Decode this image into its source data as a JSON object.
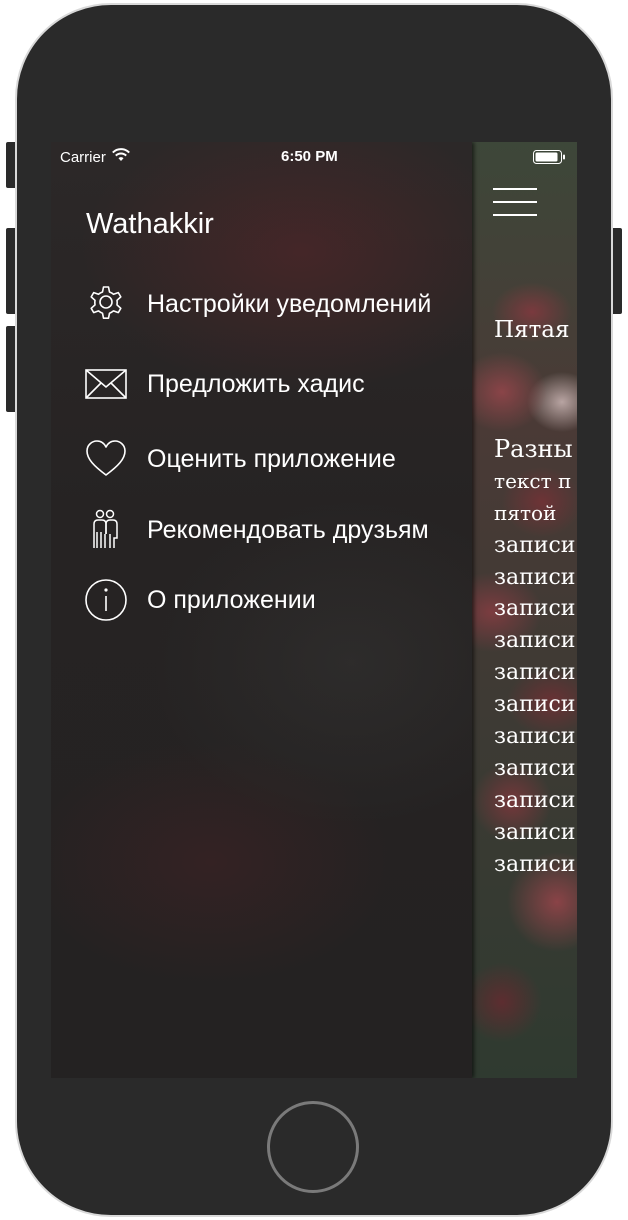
{
  "status_bar": {
    "carrier": "Carrier",
    "time": "6:50 PM"
  },
  "drawer": {
    "title": "Wathakkir",
    "items": [
      {
        "label": "Настройки уведомлений",
        "icon": "gear-icon"
      },
      {
        "label": "Предложить хадис",
        "icon": "envelope-icon"
      },
      {
        "label": "Оценить приложение",
        "icon": "heart-icon"
      },
      {
        "label": "Рекомендовать друзьям",
        "icon": "people-icon"
      },
      {
        "label": "О приложении",
        "icon": "info-icon"
      }
    ]
  },
  "main": {
    "title": "Пятая",
    "lines": [
      "Разны",
      "текст п",
      "пятой",
      "записи",
      "записи",
      "записи",
      "записи",
      "записи",
      "записи",
      "записи",
      "записи",
      "записи",
      "записи",
      "записи"
    ]
  },
  "colors": {
    "drawer_background": "#262323",
    "text": "#ffffff",
    "phone_body": "#2a2a2a"
  }
}
